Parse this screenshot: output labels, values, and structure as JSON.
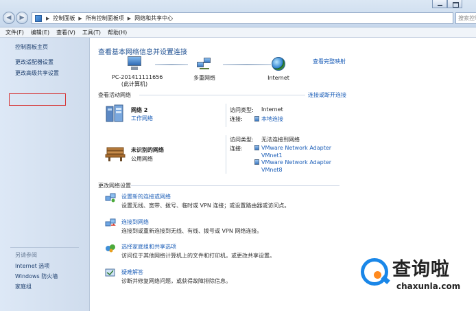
{
  "address_bar": {
    "crumbs": [
      "控制面板",
      "所有控制面板项",
      "网络和共享中心"
    ],
    "search_placeholder": "搜索控制"
  },
  "menubar": [
    "文件(F)",
    "编辑(E)",
    "查看(V)",
    "工具(T)",
    "帮助(H)"
  ],
  "sidebar": {
    "links": [
      "控制面板主页",
      "更改适配器设置",
      "更改高级共享设置"
    ],
    "see_also_title": "另请参阅",
    "see_also": [
      "Internet 选项",
      "Windows 防火墙",
      "家庭组"
    ]
  },
  "main": {
    "title": "查看基本网络信息并设置连接",
    "full_map_link": "查看完整映射",
    "nodes": {
      "pc_name": "PC-201411111656",
      "pc_sub": "(此计算机)",
      "multi": "多重网络",
      "internet": "Internet"
    },
    "active_head": "查看活动网络",
    "connect_link": "连接或断开连接",
    "net1": {
      "name": "网络  2",
      "type": "工作网络",
      "access_label": "访问类型:",
      "access_value": "Internet",
      "conn_label": "连接:",
      "conn_value": "本地连接"
    },
    "net2": {
      "name": "未识别的网络",
      "type": "公用网络",
      "access_label": "访问类型:",
      "access_value": "无法连接到网络",
      "conn_label": "连接:",
      "adapter1_line1": "VMware Network Adapter",
      "adapter1_line2": "VMnet1",
      "adapter2_line1": "VMware Network Adapter",
      "adapter2_line2": "VMnet8"
    },
    "change_head": "更改网络设置",
    "tasks": [
      {
        "title": "设置新的连接或网络",
        "desc": "设置无线、宽带、拨号、临时或 VPN 连接；或设置路由器或访问点。"
      },
      {
        "title": "连接到网络",
        "desc": "连接到或重新连接到无线、有线、拨号或 VPN 网络连接。"
      },
      {
        "title": "选择家庭组和共享选项",
        "desc": "访问位于其他网络计算机上的文件和打印机，或更改共享设置。"
      },
      {
        "title": "疑难解答",
        "desc": "诊断并修复网络问题，或获得故障排除信息。"
      }
    ]
  },
  "watermark": {
    "brand": "查询啦",
    "url": "chaxunla.com"
  }
}
